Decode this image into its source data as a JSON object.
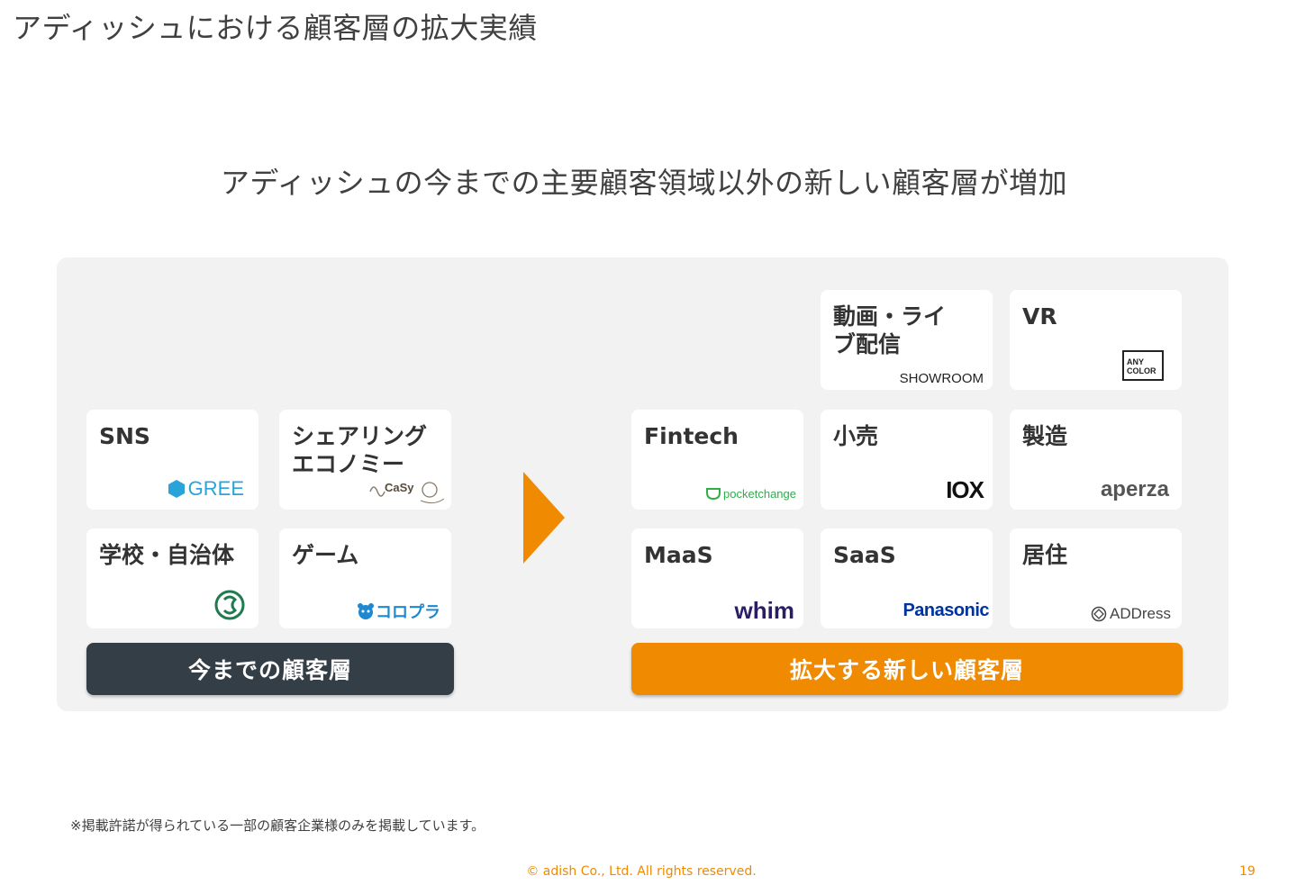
{
  "page_title": "アディッシュにおける顧客層の拡大実績",
  "subtitle": "アディッシュの今までの主要顧客領域以外の新しい顧客層が増加",
  "colors": {
    "accent": "#f08a00",
    "dark_bar": "#343e46",
    "panel": "#f2f2f2"
  },
  "existing": {
    "bar_label": "今までの顧客層",
    "cards": [
      {
        "label": "SNS",
        "logo": "GREE"
      },
      {
        "label": "シェアリング\nエコノミー",
        "logo": "CaSy"
      },
      {
        "label": "学校・自治体",
        "logo": "circle-mark"
      },
      {
        "label": "ゲーム",
        "logo": "コロプラ"
      }
    ]
  },
  "new": {
    "bar_label": "拡大する新しい顧客層",
    "cards": [
      {
        "label": "動画・ライ\nブ配信",
        "logo": "SHOWROOM"
      },
      {
        "label": "VR",
        "logo": "ANY\nCOLOR"
      },
      {
        "label": "Fintech",
        "logo": "pocketchange"
      },
      {
        "label": "小売",
        "logo": "IOX"
      },
      {
        "label": "製造",
        "logo": "aperza"
      },
      {
        "label": "MaaS",
        "logo": "whim"
      },
      {
        "label": "SaaS",
        "logo": "Panasonic"
      },
      {
        "label": "居住",
        "logo": "ADDress"
      }
    ]
  },
  "footnote": "※掲載許諾が得られている一部の顧客企業様のみを掲載しています。",
  "copyright": "© adish Co., Ltd. All rights reserved.",
  "page_number": "19"
}
